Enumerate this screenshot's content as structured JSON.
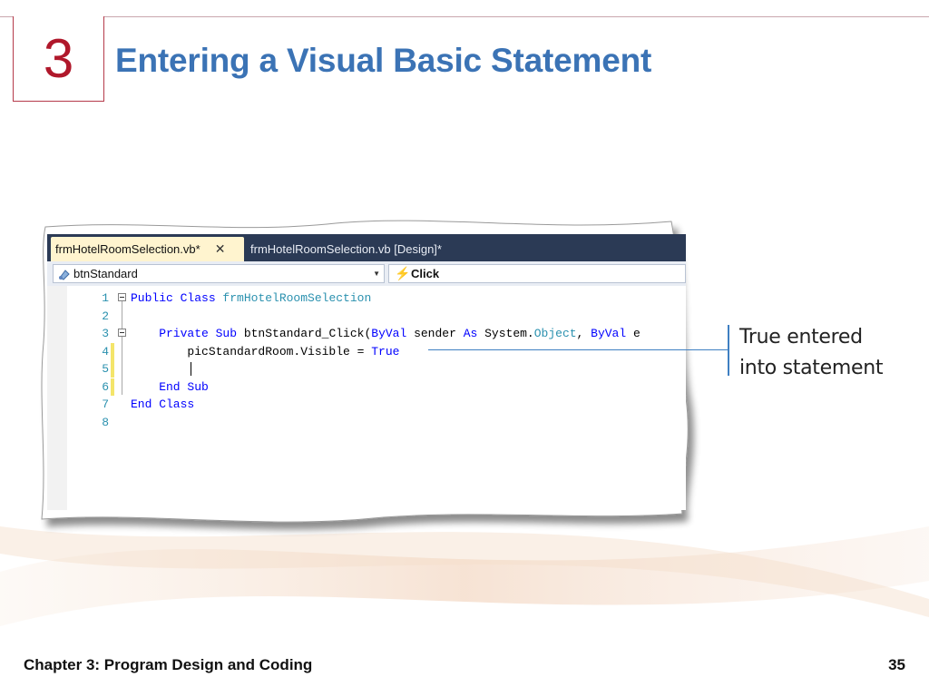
{
  "slide": {
    "number": "3",
    "title": "Entering a Visual Basic Statement",
    "footer_chapter": "Chapter 3: Program Design and Coding",
    "page_number": "35",
    "accent_color": "#b0182b",
    "title_color": "#3b73b5"
  },
  "ide": {
    "tabs": [
      {
        "label": "frmHotelRoomSelection.vb*",
        "active": true,
        "close": "✕"
      },
      {
        "label": "frmHotelRoomSelection.vb [Design]*",
        "active": false
      }
    ],
    "object_combo": "btnStandard",
    "event_combo": "Click",
    "code_lines": [
      {
        "n": "1",
        "parts": [
          {
            "t": "Public Class ",
            "c": "kw"
          },
          {
            "t": "frmHotelRoomSelection",
            "c": "ty"
          }
        ]
      },
      {
        "n": "2",
        "parts": []
      },
      {
        "n": "3",
        "parts": [
          {
            "t": "    Private Sub ",
            "c": "kw"
          },
          {
            "t": "btnStandard_Click(",
            "c": ""
          },
          {
            "t": "ByVal",
            "c": "kw"
          },
          {
            "t": " sender ",
            "c": ""
          },
          {
            "t": "As",
            "c": "kw"
          },
          {
            "t": " System.",
            "c": ""
          },
          {
            "t": "Object",
            "c": "ty"
          },
          {
            "t": ", ",
            "c": ""
          },
          {
            "t": "ByVal",
            "c": "kw"
          },
          {
            "t": " e",
            "c": ""
          }
        ]
      },
      {
        "n": "4",
        "parts": [
          {
            "t": "        picStandardRoom.Visible = ",
            "c": ""
          },
          {
            "t": "True",
            "c": "kw"
          }
        ]
      },
      {
        "n": "5",
        "parts": []
      },
      {
        "n": "6",
        "parts": [
          {
            "t": "    End Sub",
            "c": "kw"
          }
        ]
      },
      {
        "n": "7",
        "parts": [
          {
            "t": "End Class",
            "c": "kw"
          }
        ]
      },
      {
        "n": "8",
        "parts": []
      }
    ]
  },
  "callout": {
    "line1": "True entered",
    "line2": "into statement",
    "color": "#3f7fc2"
  }
}
